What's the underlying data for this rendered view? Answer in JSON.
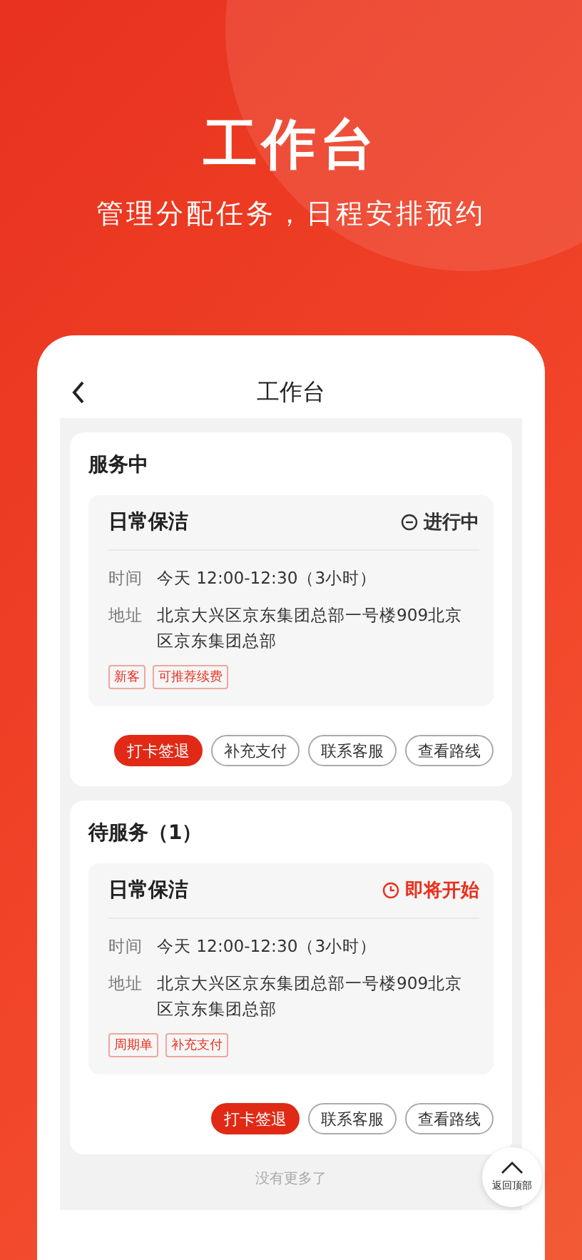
{
  "hero": {
    "title": "工作台",
    "subtitle": "管理分配任务，日程安排预约"
  },
  "phone": {
    "title": "工作台"
  },
  "sections": [
    {
      "heading": "服务中",
      "order": {
        "name": "日常保洁",
        "status": {
          "kind": "in_progress",
          "label": "进行中"
        },
        "rows": [
          {
            "label": "时间",
            "value": "今天 12:00-12:30（3小时）"
          },
          {
            "label": "地址",
            "value": "北京大兴区京东集团总部一号楼909北京区京东集团总部"
          }
        ],
        "tags": [
          "新客",
          "可推荐续费"
        ]
      },
      "actions": [
        {
          "kind": "primary",
          "label": "打卡签退"
        },
        {
          "kind": "outline",
          "label": "补充支付"
        },
        {
          "kind": "outline",
          "label": "联系客服"
        },
        {
          "kind": "outline",
          "label": "查看路线"
        }
      ]
    },
    {
      "heading": "待服务（1）",
      "order": {
        "name": "日常保洁",
        "status": {
          "kind": "upcoming",
          "label": "即将开始"
        },
        "rows": [
          {
            "label": "时间",
            "value": "今天 12:00-12:30（3小时）"
          },
          {
            "label": "地址",
            "value": "北京大兴区京东集团总部一号楼909北京区京东集团总部"
          }
        ],
        "tags": [
          "周期单",
          "补充支付"
        ]
      },
      "actions": [
        {
          "kind": "primary",
          "label": "打卡签退"
        },
        {
          "kind": "outline",
          "label": "联系客服"
        },
        {
          "kind": "outline",
          "label": "查看路线"
        }
      ]
    }
  ],
  "footer_note": "没有更多了",
  "back_to_top": {
    "label": "返回顶部"
  }
}
